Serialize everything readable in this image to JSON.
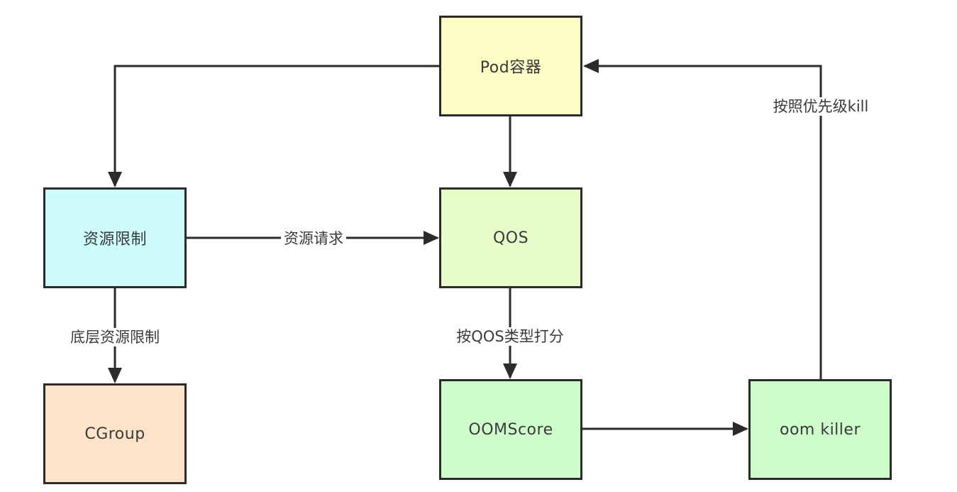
{
  "nodes": {
    "pod": {
      "label": "Pod容器",
      "color": "#fcfcc4"
    },
    "resource_limit": {
      "label": "资源限制",
      "color": "#cefcfc"
    },
    "qos": {
      "label": "QOS",
      "color": "#e6fcc9"
    },
    "cgroup": {
      "label": "CGroup",
      "color": "#fde3c8"
    },
    "oomscore": {
      "label": "OOMScore",
      "color": "#cffccb"
    },
    "oom_killer": {
      "label": "oom killer",
      "color": "#cffccb"
    }
  },
  "edges": {
    "resource_request": {
      "label": "资源请求"
    },
    "underlying_limit": {
      "label": "底层资源限制"
    },
    "score_by_qos": {
      "label": "按QOS类型打分"
    },
    "kill_by_priority": {
      "label": "按照优先级kill"
    }
  }
}
